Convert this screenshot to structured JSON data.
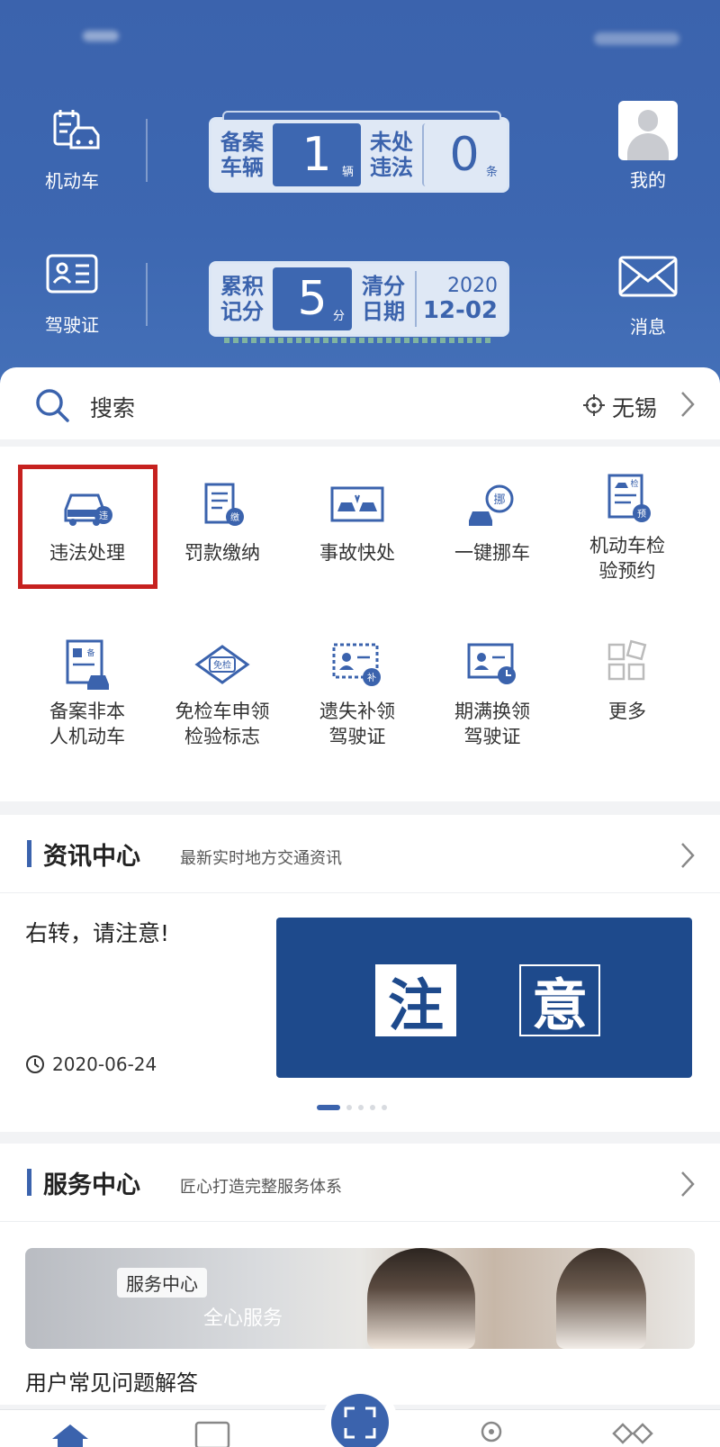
{
  "header": {
    "vehicle_label": "机动车",
    "license_label": "驾驶证",
    "profile_label": "我的",
    "message_label": "消息",
    "plate1": {
      "reg_label": "备案车辆",
      "reg_count": "1",
      "reg_unit": "辆",
      "vio_label": "未处违法",
      "vio_count": "0",
      "vio_unit": "条"
    },
    "plate2": {
      "points_label": "累积记分",
      "points": "5",
      "points_unit": "分",
      "clear_label": "清分日期",
      "clear_year": "2020",
      "clear_date": "12-02"
    }
  },
  "search": {
    "placeholder": "搜索",
    "city": "无锡"
  },
  "services": [
    {
      "label": "违法处理",
      "icon": "car-violation-icon"
    },
    {
      "label": "罚款缴纳",
      "icon": "fine-payment-icon"
    },
    {
      "label": "事故快处",
      "icon": "accident-icon"
    },
    {
      "label": "一键挪车",
      "icon": "move-car-icon"
    },
    {
      "label": "机动车检验预约",
      "icon": "inspection-booking-icon"
    },
    {
      "label": "备案非本人机动车",
      "icon": "register-vehicle-icon"
    },
    {
      "label": "免检车申领检验标志",
      "icon": "exempt-sticker-icon"
    },
    {
      "label": "遗失补领驾驶证",
      "icon": "reissue-license-icon"
    },
    {
      "label": "期满换领驾驶证",
      "icon": "renew-license-icon"
    },
    {
      "label": "更多",
      "icon": "more-grid-icon"
    }
  ],
  "service_labels_split": [
    [
      "违法处理"
    ],
    [
      "罚款缴纳"
    ],
    [
      "事故快处"
    ],
    [
      "一键挪车"
    ],
    [
      "机动车检",
      "验预约"
    ],
    [
      "备案非本",
      "人机动车"
    ],
    [
      "免检车申领",
      "检验标志"
    ],
    [
      "遗失补领",
      "驾驶证"
    ],
    [
      "期满换领",
      "驾驶证"
    ],
    [
      "更多"
    ]
  ],
  "news": {
    "title": "资讯中心",
    "subtitle": "最新实时地方交通资讯",
    "headline": "右转，请注意!",
    "date": "2020-06-24",
    "banner_char1": "注",
    "banner_char2": "意"
  },
  "service_center": {
    "title": "服务中心",
    "subtitle": "匠心打造完整服务体系",
    "badge": "服务中心",
    "slogan": "全心服务",
    "faq": "用户常见问题解答"
  },
  "colors": {
    "brand_blue": "#3b63ad",
    "highlight_red": "#c6211f",
    "banner_blue": "#1e4a8c"
  }
}
